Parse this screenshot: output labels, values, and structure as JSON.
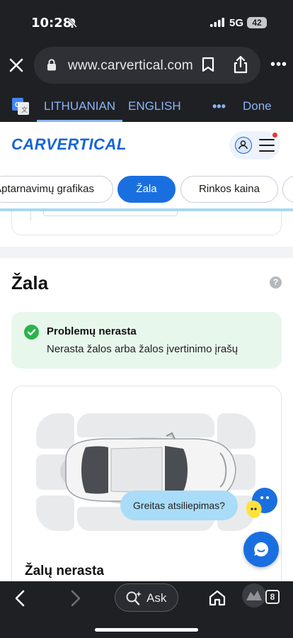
{
  "status_bar": {
    "time": "10:28",
    "network": "5G",
    "battery": "42"
  },
  "browser": {
    "url": "www.carvertical.com",
    "more_label": "•••"
  },
  "translate_bar": {
    "source_lang": "LITHUANIAN",
    "target_lang": "ENGLISH",
    "more_label": "•••",
    "done_label": "Done"
  },
  "site": {
    "logo_text": "CARVERTICAL",
    "tabs": [
      {
        "label": "Aptarnavimų grafikas",
        "active": false
      },
      {
        "label": "Žala",
        "active": true
      },
      {
        "label": "Rinkos kaina",
        "active": false
      }
    ]
  },
  "damage_section": {
    "title": "Žala",
    "help_label": "?",
    "status": {
      "title": "Problemų nerasta",
      "text": "Nerasta žalos arba žalos įvertinimo įrašų"
    },
    "diagram_caption": "Žalų nerasta"
  },
  "widgets": {
    "feedback_label": "Greitas atsiliepimas?"
  },
  "toolbar": {
    "ask_label": "Ask",
    "tab_count": "8"
  },
  "colors": {
    "brand_blue": "#1664d8",
    "chip_active": "#1a6fe0",
    "success_green": "#2bb24c",
    "success_bg": "#e8f7ec",
    "chrome_dark": "#1f2024",
    "translate_accent": "#8ab4f8"
  }
}
